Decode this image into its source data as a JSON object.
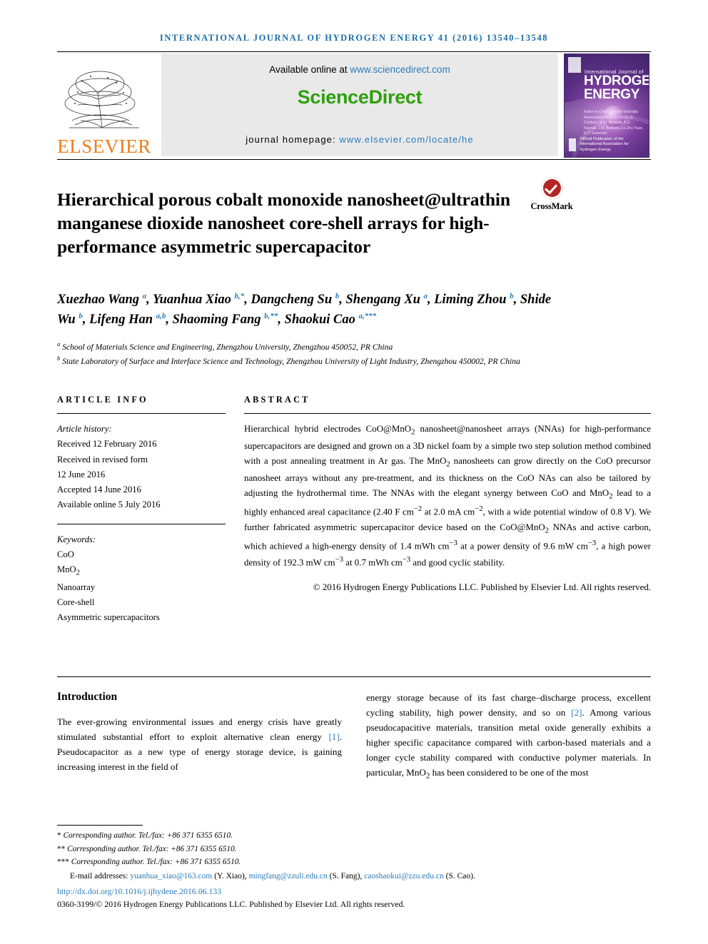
{
  "running_head": "International Journal of Hydrogen Energy 41 (2016) 13540–13548",
  "masthead": {
    "publisher_name": "ELSEVIER",
    "available_prefix": "Available online at ",
    "available_url": "www.sciencedirect.com",
    "sciencedirect_logo": "ScienceDirect",
    "homepage_prefix": "journal homepage: ",
    "homepage_url": "www.elsevier.com/locate/he",
    "cover": {
      "small_title": "International Journal of",
      "big_title_line1": "HYDROGEN",
      "big_title_line2": "ENERGY",
      "editors": "Editor-in-Chief: T. Nejat Veziroğlu\nAssociate Editors: S. Dunn, D. Cordaro, H. H. Almeida, B.Z. Kaynak, J.M. Bellosta, Lu Zhu Yuan, D.Y. Goswami",
      "footer_text": "Official Publication of the\nInternational Association for\nHydrogen Energy"
    }
  },
  "title": "Hierarchical porous cobalt monoxide nanosheet@ultrathin manganese dioxide nanosheet core-shell arrays for high-performance asymmetric supercapacitor",
  "crossmark": {
    "label": "CrossMark",
    "color": "#b32626"
  },
  "authors_html": "Xuezhao Wang <sup>a</sup>, Yuanhua Xiao <sup>b,*</sup>, Dangcheng Su <sup>b</sup>, Shengang Xu <sup>a</sup>, Liming Zhou <sup>b</sup>, Shide Wu <sup>b</sup>, Lifeng Han <sup>a,b</sup>, Shaoming Fang <sup>b,**</sup>, Shaokui Cao <sup>a,***</sup>",
  "affiliations": [
    "<sup>a</sup> School of Materials Science and Engineering, Zhengzhou University, Zhengzhou 450052, PR China",
    "<sup>b</sup> State Laboratory of Surface and Interface Science and Technology, Zhengzhou University of Light Industry, Zhengzhou 450002, PR China"
  ],
  "article_info": {
    "heading": "ARTICLE INFO",
    "history_label": "Article history:",
    "history": [
      "Received 12 February 2016",
      "Received in revised form",
      "12 June 2016",
      "Accepted 14 June 2016",
      "Available online 5 July 2016"
    ],
    "keywords_label": "Keywords:",
    "keywords_html": "CoO<br>MnO<sub>2</sub><br>Nanoarray<br>Core-shell<br>Asymmetric supercapacitors"
  },
  "abstract": {
    "heading": "ABSTRACT",
    "text_html": "Hierarchical hybrid electrodes CoO@MnO<sub>2</sub> nanosheet@nanosheet arrays (NNAs) for high-performance supercapacitors are designed and grown on a 3D nickel foam by a simple two step solution method combined with a post annealing treatment in Ar gas. The MnO<sub>2</sub> nanosheets can grow directly on the CoO precursor nanosheet arrays without any pre-treatment, and its thickness on the CoO NAs can also be tailored by adjusting the hydrothermal time. The NNAs with the elegant synergy between CoO and MnO<sub>2</sub> lead to a highly enhanced areal capacitance (2.40 F cm<sup>−2</sup> at 2.0 mA cm<sup>−2</sup>, with a wide potential window of 0.8 V). We further fabricated asymmetric supercapacitor device based on the CoO@MnO<sub>2</sub> NNAs and active carbon, which achieved a high-energy density of 1.4 mWh cm<sup>−3</sup> at a power density of 9.6 mW cm<sup>−3</sup>, a high power density of 192.3 mW cm<sup>−3</sup> at 0.7 mWh cm<sup>−3</sup> and good cyclic stability.",
    "copyright": "© 2016 Hydrogen Energy Publications LLC. Published by Elsevier Ltd. All rights reserved."
  },
  "body": {
    "section_heading": "Introduction",
    "left_column_html": "The ever-growing environmental issues and energy crisis have greatly stimulated substantial effort to exploit alternative clean energy <span class=\"ref\">[1]</span>. Pseudocapacitor as a new type of energy storage device, is gaining increasing interest in the field of",
    "right_column_html": "energy storage because of its fast charge–discharge process, excellent cycling stability, high power density, and so on <span class=\"ref\">[2]</span>. Among various pseudocapacitive materials, transition metal oxide generally exhibits a higher specific capacitance compared with carbon-based materials and a longer cycle stability compared with conductive polymer materials. In particular, MnO<sub>2</sub> has been considered to be one of the most"
  },
  "footnotes": {
    "corresponding": [
      {
        "marker": "*",
        "text": "Corresponding author. Tel./fax: +86 371 6355 6510."
      },
      {
        "marker": "**",
        "text": "Corresponding author. Tel./fax: +86 371 6355 6510."
      },
      {
        "marker": "***",
        "text": "Corresponding author. Tel./fax: +86 371 6355 6510."
      }
    ],
    "email_html": "E-mail addresses: <span class=\"em-link\">yuanhua_xiao@163.com</span> (Y. Xiao), <span class=\"em-link\">mingfang@zzuli.edu.cn</span> (S. Fang), <span class=\"em-link\">caoshaokui@zzu.edu.cn</span> (S. Cao).",
    "doi": "http://dx.doi.org/10.1016/j.ijhydene.2016.06.133",
    "issn_line": "0360-3199/© 2016 Hydrogen Energy Publications LLC. Published by Elsevier Ltd. All rights reserved."
  }
}
